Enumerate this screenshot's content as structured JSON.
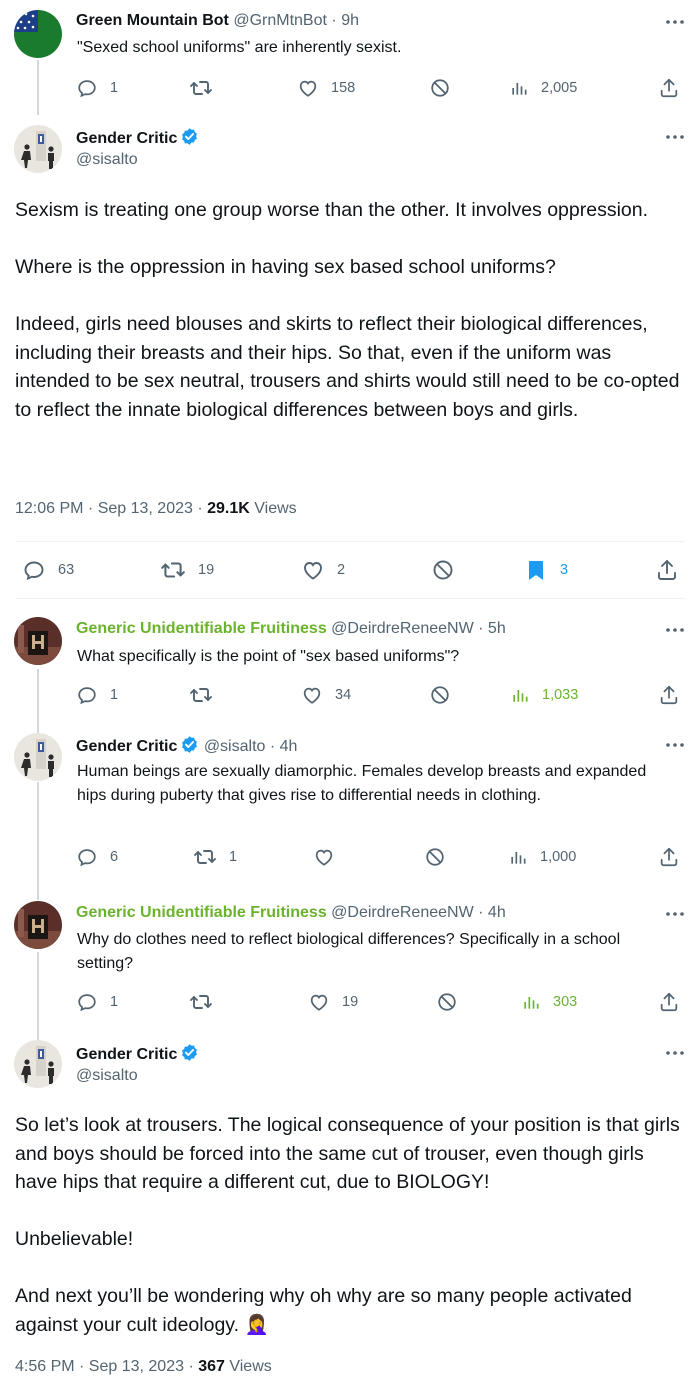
{
  "tweets": {
    "t1": {
      "name": "Green Mountain Bot",
      "handle": "@GrnMtnBot",
      "dot": "·",
      "time": "9h",
      "text": "\"Sexed school uniforms\" are inherently sexist.",
      "replies": "1",
      "retweets": "",
      "likes": "158",
      "views": "2,005"
    },
    "main": {
      "name": "Gender Critic",
      "handle": "@sisalto",
      "paragraphs": [
        "Sexism is treating one group worse than the other. It involves oppression.",
        "Where is the oppression in having sex based school uniforms?",
        "Indeed, girls need blouses and skirts to reflect their biological differences, including their breasts and their hips. So that, even if the uniform was intended to be sex neutral, trousers and shirts would still need to be co-opted to reflect the innate biological differences between boys and girls."
      ],
      "timestamp": "12:06 PM · Sep 13, 2023 · ",
      "views_count": "29.1K",
      "views_label": " Views",
      "replies": "63",
      "retweets": "19",
      "likes": "2",
      "bookmarks": "3"
    },
    "t3": {
      "name": "Generic Unidentifiable Fruitiness",
      "handle": "@DeirdreReneeNW",
      "dot": "·",
      "time": "5h",
      "text": "What specifically is the point of \"sex based uniforms\"?",
      "replies": "1",
      "retweets": "",
      "likes": "34",
      "views": "1,033"
    },
    "t4": {
      "name": "Gender Critic",
      "handle": "@sisalto",
      "dot": "·",
      "time": "4h",
      "text": "Human beings are sexually diamorphic. Females develop breasts and expanded hips during puberty that gives rise to differential needs in clothing.",
      "replies": "6",
      "retweets": "1",
      "likes": "",
      "views": "1,000"
    },
    "t5": {
      "name": "Generic Unidentifiable Fruitiness",
      "handle": "@DeirdreReneeNW",
      "dot": "·",
      "time": "4h",
      "text": "Why do clothes need to reflect biological differences?  Specifically in a school setting?",
      "replies": "1",
      "retweets": "",
      "likes": "19",
      "views": "303"
    },
    "main2": {
      "name": "Gender Critic",
      "handle": "@sisalto",
      "paragraphs": [
        "So let’s look at trousers. The logical consequence of your position is that girls and boys should be forced into the same cut of trouser, even though girls have hips that require a different cut, due to BIOLOGY!",
        "Unbelievable!",
        "And next you’ll be wondering why oh why are so many people activated against your cult ideology. 🤦‍♀️"
      ],
      "timestamp": "4:56 PM · Sep 13, 2023 · ",
      "views_count": "367",
      "views_label": " Views"
    }
  },
  "colors": {
    "text": "#0f1419",
    "secondary": "#536471",
    "green_name": "#6bb32e",
    "verified": "#1d9bf0",
    "bookmark": "#1d9bf0",
    "thread_line": "#cfd9de"
  },
  "icons": [
    "reply-icon",
    "retweet-icon",
    "like-icon",
    "block-icon",
    "views-icon",
    "share-icon",
    "bookmark-icon",
    "verified-icon",
    "more-icon"
  ]
}
